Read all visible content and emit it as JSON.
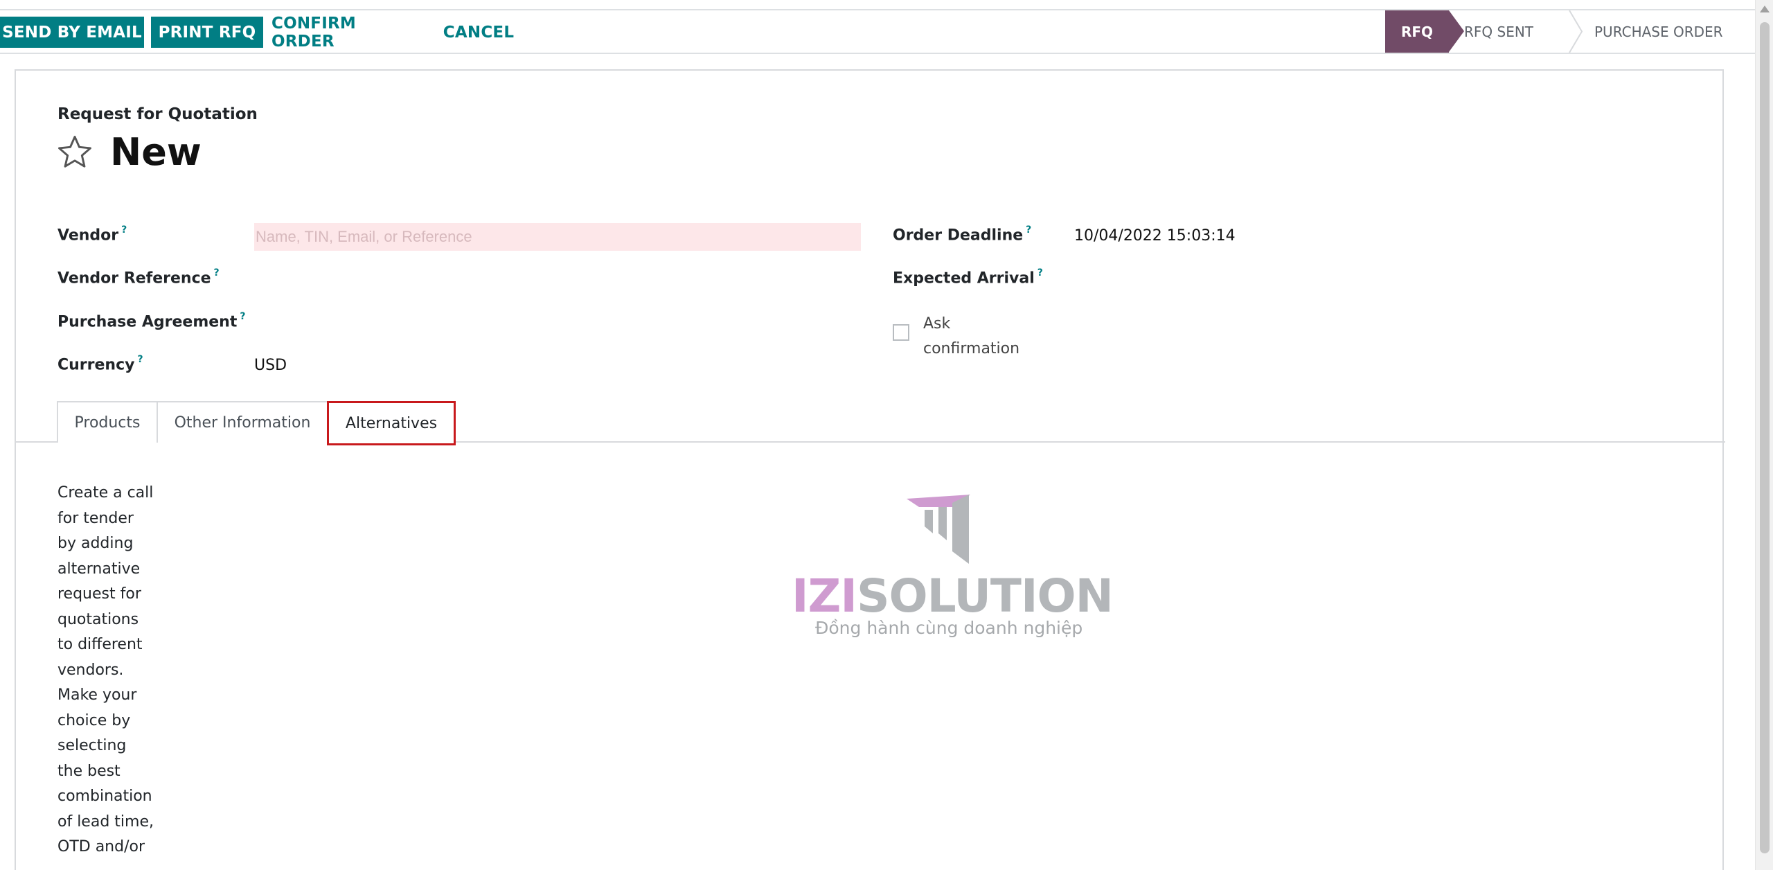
{
  "toolbar": {
    "send_email": "SEND BY EMAIL",
    "print_rfq": "PRINT RFQ",
    "confirm_order": "CONFIRM ORDER",
    "cancel": "CANCEL"
  },
  "status": {
    "stages": [
      "RFQ",
      "RFQ SENT",
      "PURCHASE ORDER"
    ],
    "active": "RFQ"
  },
  "doc": {
    "subtitle": "Request for Quotation",
    "title": "New"
  },
  "fields": {
    "vendor_label": "Vendor",
    "vendor_placeholder": "Name, TIN, Email, or Reference",
    "vendor_ref_label": "Vendor Reference",
    "purchase_agreement_label": "Purchase Agreement",
    "currency_label": "Currency",
    "currency_value": "USD",
    "order_deadline_label": "Order Deadline",
    "order_deadline_value": "10/04/2022 15:03:14",
    "expected_arrival_label": "Expected Arrival",
    "ask_confirmation_line1": "Ask",
    "ask_confirmation_line2": "confirmation",
    "help_mark": "?"
  },
  "tabs": {
    "items": [
      "Products",
      "Other Information",
      "Alternatives"
    ],
    "active": "Alternatives"
  },
  "alternatives_help": [
    "Create a call",
    "for tender",
    "by adding",
    "alternative",
    "request for",
    "quotations",
    "to different",
    "vendors.",
    "Make your",
    "choice by",
    "selecting",
    "the best",
    "combination",
    "of lead time,",
    "OTD and/or"
  ],
  "watermark": {
    "brand_a": "IZI",
    "brand_b": "SOLUTION",
    "tagline": "Đồng hành cùng doanh nghiệp"
  },
  "colors": {
    "primary": "#017e84",
    "active_stage": "#714b67",
    "highlight": "#c8191c"
  }
}
